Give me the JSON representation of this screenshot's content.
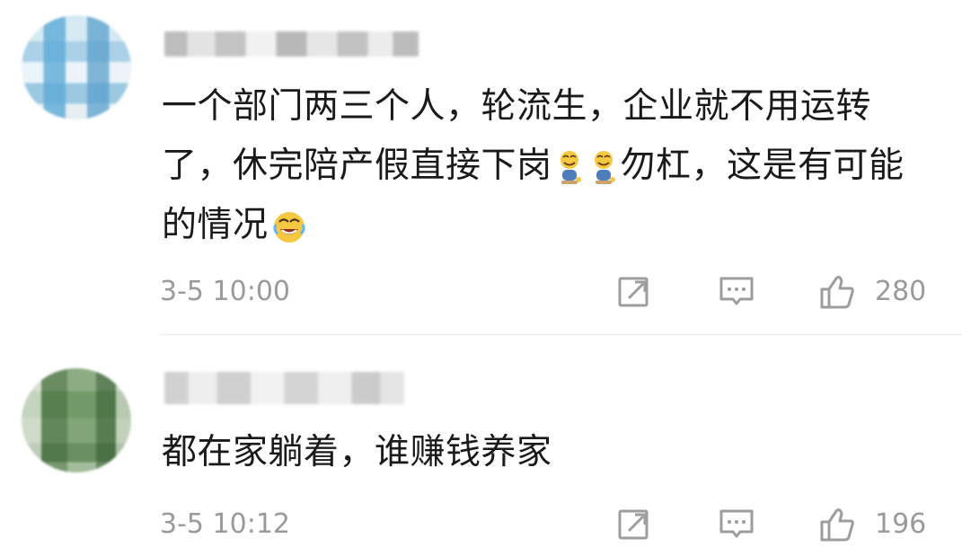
{
  "comments": [
    {
      "username": "",
      "text_segments": [
        "一个部门两三个人，轮流生，企业就不用运转了，休完陪产假直接下岗",
        "勿杠，这是有可能的情况"
      ],
      "timestamp": "3-5 10:00",
      "like_count": "280",
      "emoji_names": [
        "baby-emoji",
        "baby-emoji",
        "laughing-crying-emoji"
      ]
    },
    {
      "username": "",
      "text": "都在家躺着，谁赚钱养家",
      "timestamp": "3-5 10:12",
      "like_count": "196"
    }
  ],
  "icons": {
    "share": "share-icon",
    "reply": "reply-icon",
    "like": "like-icon"
  },
  "colors": {
    "background": "#ffffff",
    "text": "#1a1a1a",
    "secondary_text": "#9a9a9a",
    "divider": "#ebebeb",
    "emoji_yellow": "#f5c842"
  }
}
